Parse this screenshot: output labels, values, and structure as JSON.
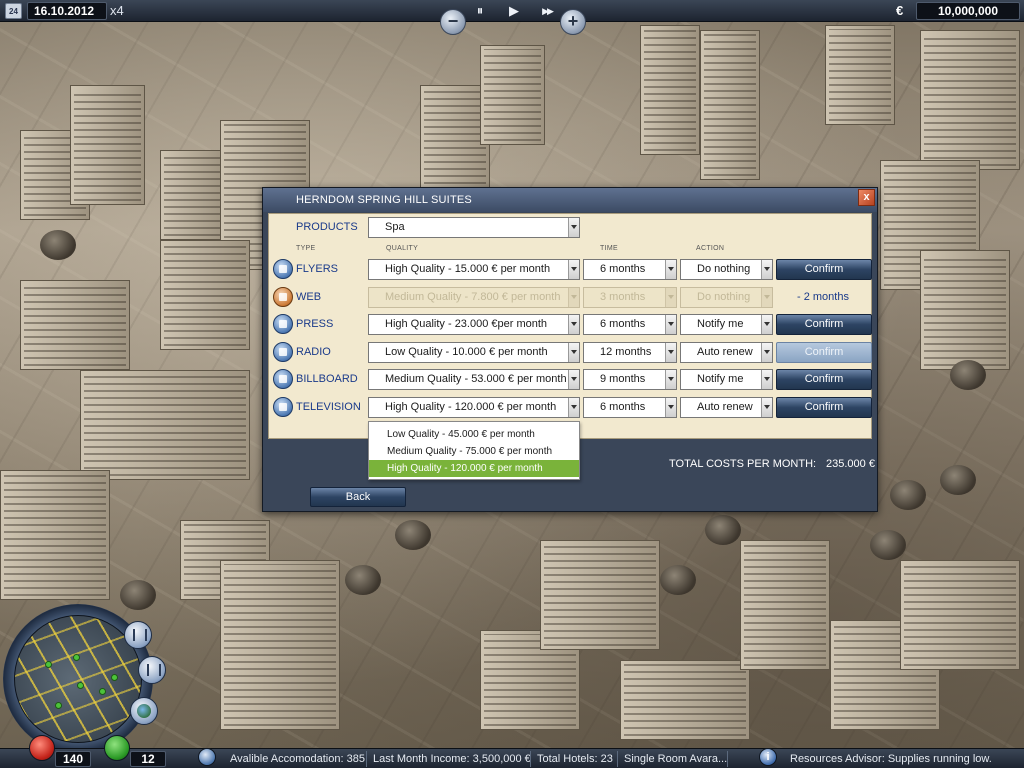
{
  "top_bar": {
    "calendar_icon": "calendar-icon",
    "calendar_day": "24",
    "date": "16.10.2012",
    "speed": "x4",
    "currency_symbol": "€",
    "money": "10,000,000",
    "zoom_out_glyph": "−",
    "pause_glyph": "⏸",
    "play_glyph": "▶",
    "fast_forward_glyph": "▶▶",
    "zoom_in_glyph": "+"
  },
  "dialog": {
    "title": "HERNDOM SPRING HILL SUITES",
    "close_glyph": "x",
    "products_label": "PRODUCTS",
    "product_selected": "Spa",
    "col_type": "TYPE",
    "col_quality": "QUALITY",
    "col_time": "TIME",
    "col_action": "ACTION",
    "rows": [
      {
        "icon": "flyer-icon",
        "type": "FLYERS",
        "quality": "High Quality - 15.000 € per month",
        "time": "6 months",
        "action": "Do nothing",
        "confirm": "Confirm",
        "active": true
      },
      {
        "icon": "web-icon",
        "type": "WEB",
        "quality": "Medium Quality - 7.800 € per month",
        "time": "3 months",
        "action": "Do nothing",
        "remaining": "- 2 months",
        "active": false
      },
      {
        "icon": "press-icon",
        "type": "PRESS",
        "quality": "High Quality - 23.000 €per month",
        "time": "6 months",
        "action": "Notify me",
        "confirm": "Confirm",
        "active": true
      },
      {
        "icon": "radio-icon",
        "type": "RADIO",
        "quality": "Low Quality - 10.000 € per month",
        "time": "12 months",
        "action": "Auto renew",
        "confirm": "Confirm",
        "active": true,
        "confirm_highlighted": true
      },
      {
        "icon": "billboard-icon",
        "type": "BILLBOARD",
        "quality": "Medium Quality - 53.000 € per month",
        "time": "9 months",
        "action": "Notify me",
        "confirm": "Confirm",
        "active": true
      },
      {
        "icon": "television-icon",
        "type": "TELEVISION",
        "quality": "High Quality - 120.000 € per month",
        "time": "6 months",
        "action": "Auto renew",
        "confirm": "Confirm",
        "active": true
      }
    ],
    "open_dropdown": {
      "options": [
        "Low Quality - 45.000 € per month",
        "Medium Quality - 75.000 € per month",
        "High Quality - 120.000 € per month"
      ],
      "selected_index": 2
    },
    "total_label": "TOTAL COSTS PER MONTH:",
    "total_value": "235.000 €",
    "back_label": "Back"
  },
  "minimap": {
    "buttons": [
      "building-icon",
      "bank-icon",
      "globe-icon"
    ]
  },
  "bottom_bar": {
    "red_count": "140",
    "green_count": "12",
    "available_accommodation": "Avalible Accomodation: 385",
    "last_month_income": "Last Month Income: 3,500,000 €",
    "total_hotels": "Total Hotels: 23",
    "single_room": "Single Room Avara...",
    "info_glyph": "i",
    "advisor_message": "Resources Advisor: Supplies running low."
  },
  "colors": {
    "bar_bg": "#1d2430",
    "dialog_bg": "#3a4659",
    "panel_bg": "#f2e9cf",
    "label_blue": "#1a3a8a",
    "confirm_btn": "#2d4463",
    "dropdown_selected": "#7ab33a"
  }
}
